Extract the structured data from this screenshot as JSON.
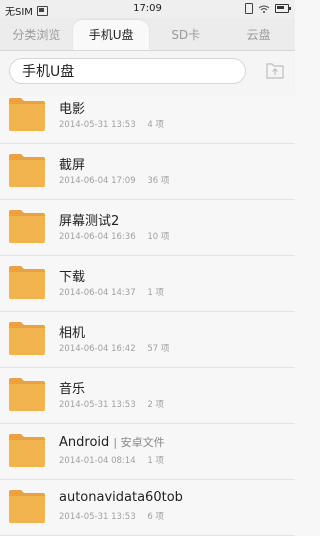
{
  "status_bar": {
    "carrier": "无SIM",
    "time": "17:09"
  },
  "tabs": [
    {
      "label": "分类浏览",
      "active": false
    },
    {
      "label": "手机U盘",
      "active": true
    },
    {
      "label": "SD卡",
      "active": false
    },
    {
      "label": "云盘",
      "active": false
    }
  ],
  "path": {
    "current": "手机U盘"
  },
  "files": [
    {
      "name": "电影",
      "subtitle": "",
      "date": "2014-05-31 13:53",
      "count": "4 项"
    },
    {
      "name": "截屏",
      "subtitle": "",
      "date": "2014-06-04 17:09",
      "count": "36 项"
    },
    {
      "name": "屏幕测试2",
      "subtitle": "",
      "date": "2014-06-04 16:36",
      "count": "10 项"
    },
    {
      "name": "下载",
      "subtitle": "",
      "date": "2014-06-04 14:37",
      "count": "1 项"
    },
    {
      "name": "相机",
      "subtitle": "",
      "date": "2014-06-04 16:42",
      "count": "57 项"
    },
    {
      "name": "音乐",
      "subtitle": "",
      "date": "2014-05-31 13:53",
      "count": "2 项"
    },
    {
      "name": "Android",
      "subtitle": "| 安卓文件",
      "date": "2014-01-04 08:14",
      "count": "1 项"
    },
    {
      "name": "autonavidata60tob",
      "subtitle": "",
      "date": "2014-05-31 13:53",
      "count": "6 项"
    }
  ],
  "colors": {
    "folder_body": "#f2b44f",
    "folder_tab": "#e9a23d",
    "tab_bar": "#ececec"
  },
  "icons": {
    "status_left": "sim-card-icon",
    "status_right": [
      "vibrate-icon",
      "wifi-icon",
      "battery-icon"
    ],
    "path_action": "upload-icon",
    "row": "folder-icon"
  }
}
